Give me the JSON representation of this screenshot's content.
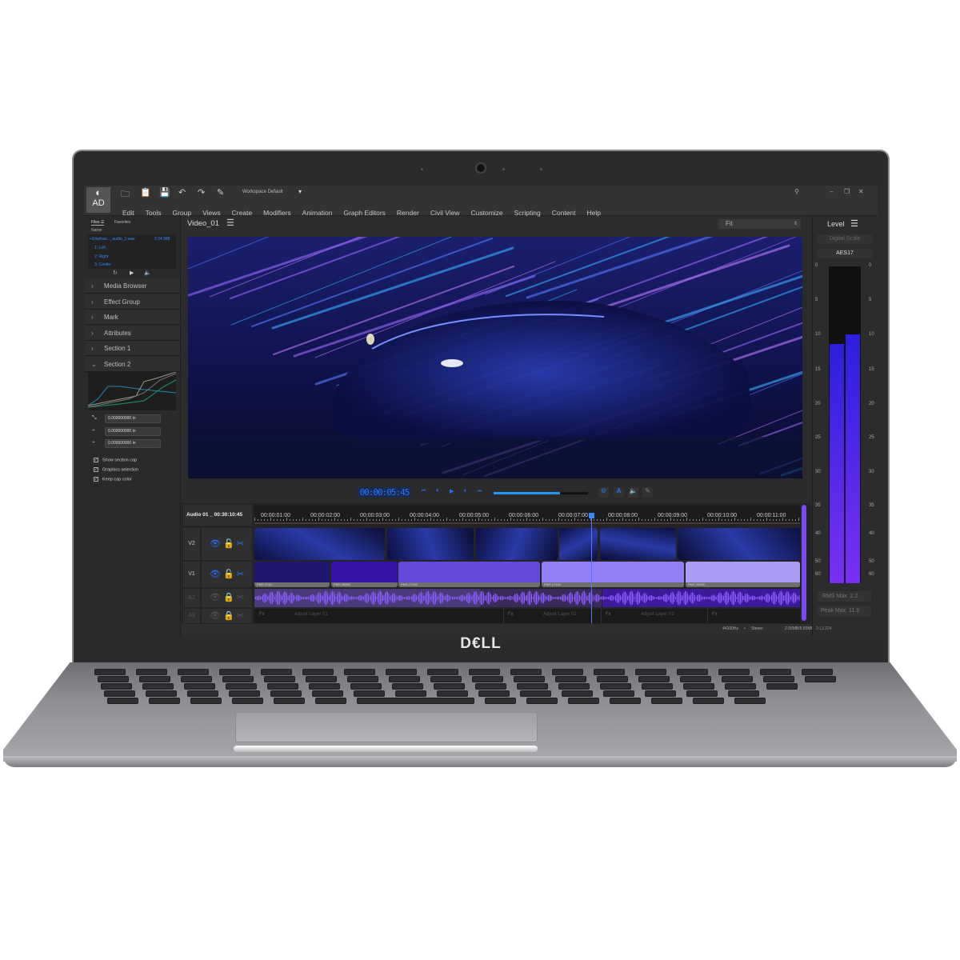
{
  "brand": {
    "logo": "DELL"
  },
  "app": {
    "logo_letters": "AD",
    "workspace": "Workspace Default",
    "menu": [
      "Edit",
      "Tools",
      "Group",
      "Views",
      "Create",
      "Modifiers",
      "Animation",
      "Graph Editors",
      "Render",
      "Civil View",
      "Customize",
      "Scripting",
      "Content",
      "Help"
    ],
    "toolbar_icons": [
      "folder-icon",
      "clipboard-icon",
      "save-icon",
      "undo-icon",
      "redo-icon",
      "edit-icon"
    ]
  },
  "left_panel": {
    "tabs": [
      "Files",
      "Favorites"
    ],
    "column": "Name",
    "file": {
      "name": "Elephan..._audio_1.wav",
      "duration": "2:34.988"
    },
    "channels": [
      "1: Left",
      "2: Right",
      "3: Center"
    ],
    "sections": [
      "Media Browser",
      "Effect Group",
      "Mark",
      "Attributes",
      "Section 1",
      "Section 2"
    ],
    "inputs": [
      "0.000000000 in",
      "0.000000000 in",
      "0.000000000 in"
    ],
    "checkboxes": [
      {
        "label": "Show section cap",
        "checked": true
      },
      {
        "label": "Graphics selection",
        "checked": true
      },
      {
        "label": "Keep cap color",
        "checked": true
      }
    ]
  },
  "viewer": {
    "title": "Video_01",
    "zoom": "Fit"
  },
  "transport": {
    "timecode": "00:00:05:45",
    "progress": 0.7
  },
  "timeline": {
    "label": "Audio 01 _ 00:30:10:45",
    "ruler": [
      "00:00:01:00",
      "00:00:02:00",
      "00:00:03:00",
      "00:00:04:00",
      "00:00:05:00",
      "00:00:06:00",
      "00:00:07:00",
      "00:00:08:00",
      "00:00:09:00",
      "00:00:10:00",
      "00:00:11:00"
    ],
    "tracks": [
      "V2",
      "V1",
      "A2",
      "A3"
    ],
    "v1_clips": [
      {
        "label": "PMS 274C",
        "color": "#1f1670"
      },
      {
        "label": "PMS 2685C",
        "color": "#3612a8"
      },
      {
        "label": "PMS 2725C",
        "color": "#6548dc"
      },
      {
        "label": "PMS 2715C",
        "color": "#9180fa"
      },
      {
        "label": "PMS 2655C",
        "color": "#a99cf5"
      }
    ],
    "adjust_layers": [
      "Adjust Layer 01",
      "Adjust Layer 02",
      "Adjust Layer 03"
    ],
    "fx": "Fx"
  },
  "status": {
    "rate": "44100Hz",
    "channels": "Stereo",
    "memory": "2.05MB/5.60MB",
    "time": "2:13.224"
  },
  "level": {
    "title": "Level",
    "scale_mode": "Digital Scale",
    "standard": "AES17",
    "ticks": [
      "0",
      "5",
      "10",
      "15",
      "20",
      "25",
      "30",
      "35",
      "40",
      "50",
      "60"
    ],
    "left_level_fraction": 0.755,
    "right_level_fraction": 0.785,
    "rms_label": "RMS Max",
    "rms": "2.2",
    "peak_label": "Peak Max",
    "peak": "11.9"
  },
  "colors": {
    "accent": "#1e78ff",
    "meter_top": "#2a1fe0",
    "meter_bottom": "#7a2ff5"
  }
}
